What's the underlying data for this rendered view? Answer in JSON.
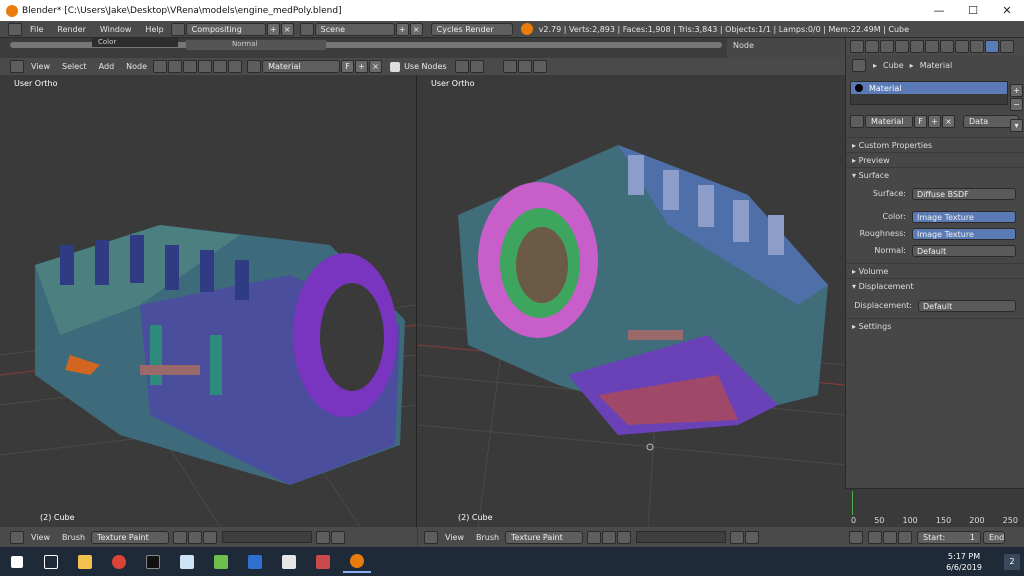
{
  "window": {
    "title": "Blender* [C:\\Users\\Jake\\Desktop\\VRena\\models\\engine_medPoly.blend]",
    "min": "—",
    "max": "☐",
    "close": "✕"
  },
  "infobar": {
    "menus": [
      "File",
      "Render",
      "Window",
      "Help"
    ],
    "layout": "Compositing",
    "scene": "Scene",
    "engine": "Cycles Render",
    "stats": "v2.79 | Verts:2,893 | Faces:1,908 | Tris:3,843 | Objects:1/1 | Lamps:0/0 | Mem:22.49M | Cube"
  },
  "node_strip": {
    "color": "Color",
    "normal": "Normal",
    "node_label": "Node"
  },
  "node_header": {
    "menus": [
      "View",
      "Select",
      "Add",
      "Node"
    ],
    "material": "Material",
    "f": "F",
    "use_nodes": "Use Nodes"
  },
  "viewports": [
    {
      "label": "User Ortho",
      "object": "(2) Cube",
      "menus": [
        "View",
        "Brush"
      ],
      "mode": "Texture Paint"
    },
    {
      "label": "User Ortho",
      "object": "(2) Cube",
      "menus": [
        "View",
        "Brush"
      ],
      "mode": "Texture Paint"
    }
  ],
  "properties": {
    "breadcrumb": [
      "Cube",
      "Material"
    ],
    "slot": "Material",
    "material_name": "Material",
    "f": "F",
    "data": "Data",
    "panels": {
      "custom": "Custom Properties",
      "preview": "Preview",
      "surface": "Surface",
      "volume": "Volume",
      "displacement": "Displacement",
      "settings": "Settings"
    },
    "surface": {
      "surface_label": "Surface:",
      "surface_val": "Diffuse BSDF",
      "color_label": "Color:",
      "color_val": "Image Texture",
      "rough_label": "Roughness:",
      "rough_val": "Image Texture",
      "normal_label": "Normal:",
      "normal_val": "Default"
    },
    "displacement": {
      "label": "Displacement:",
      "val": "Default"
    }
  },
  "timeline": {
    "ticks": [
      "0",
      "50",
      "100",
      "150",
      "200",
      "250"
    ],
    "start": "Start:",
    "start_val": "1",
    "end": "End"
  },
  "taskbar": {
    "time": "5:17 PM",
    "date": "6/6/2019",
    "notif": "2"
  }
}
